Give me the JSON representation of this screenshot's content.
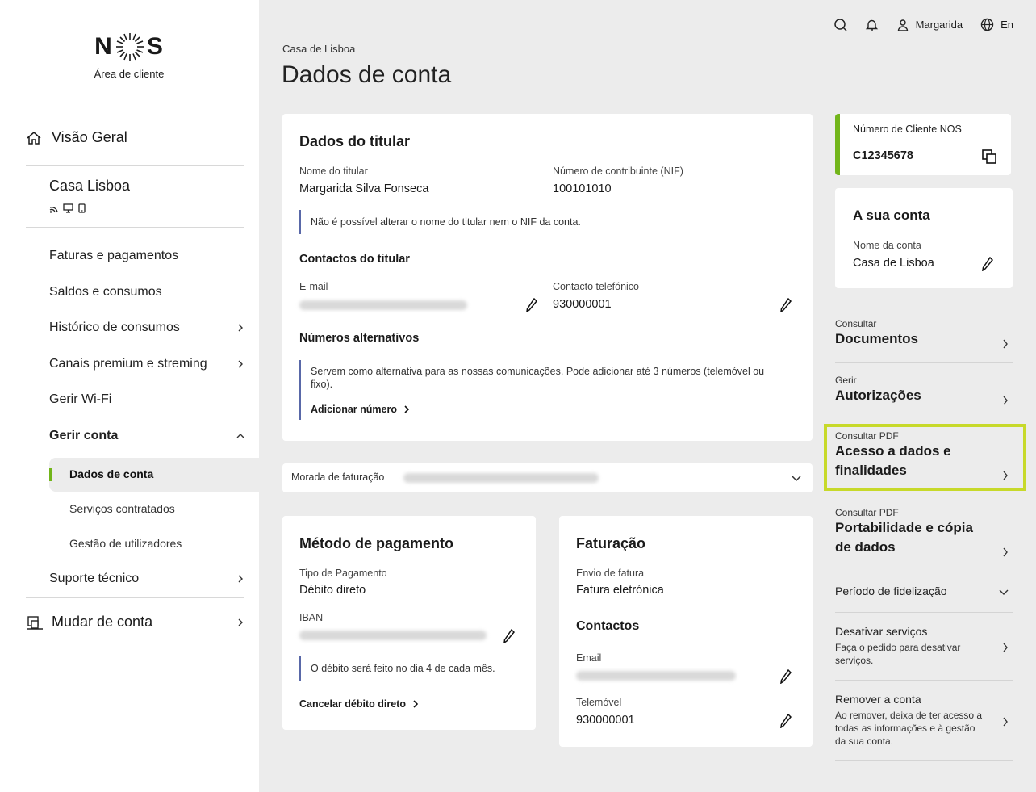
{
  "brand": {
    "logo_left": "N",
    "logo_right": "S",
    "subtitle": "Área de cliente"
  },
  "sidebar": {
    "overview": "Visão Geral",
    "account_name": "Casa Lisboa",
    "items": [
      {
        "label": "Faturas e pagamentos"
      },
      {
        "label": "Saldos e consumos"
      },
      {
        "label": "Histórico de consumos"
      },
      {
        "label": "Canais premium e streming"
      },
      {
        "label": "Gerir Wi-Fi"
      },
      {
        "label": "Gerir conta"
      }
    ],
    "sub_items": [
      {
        "label": "Dados de conta"
      },
      {
        "label": "Serviços contratados"
      },
      {
        "label": "Gestão de utilizadores"
      }
    ],
    "support": "Suporte técnico",
    "switch_account": "Mudar de conta"
  },
  "topbar": {
    "user": "Margarida",
    "language": "En"
  },
  "breadcrumb": "Casa de Lisboa",
  "page_title": "Dados de conta",
  "holder": {
    "title": "Dados do titular",
    "name_label": "Nome do titular",
    "name": "Margarida Silva Fonseca",
    "nif_label": "Número de contribuinte (NIF)",
    "nif": "100101010",
    "note": "Não é possível alterar o nome do titular nem o NIF da conta.",
    "contacts_title": "Contactos do titular",
    "email_label": "E-mail",
    "phone_label": "Contacto telefónico",
    "phone": "930000001",
    "alt_title": "Números alternativos",
    "alt_note": "Servem como alternativa para as nossas comunicações. Pode adicionar até 3 números (telemóvel ou fixo).",
    "add_number": "Adicionar número"
  },
  "billing_address": {
    "label": "Morada de faturação"
  },
  "payment": {
    "title": "Método de pagamento",
    "type_label": "Tipo de Pagamento",
    "type": "Débito direto",
    "iban_label": "IBAN",
    "note": "O débito será feito no dia 4 de cada mês.",
    "cancel": "Cancelar débito direto"
  },
  "invoice": {
    "title": "Faturação",
    "send_label": "Envio de fatura",
    "send": "Fatura eletrónica",
    "contacts_title": "Contactos",
    "email_label": "Email",
    "mobile_label": "Telemóvel",
    "mobile": "930000001"
  },
  "client_number": {
    "label": "Número de Cliente NOS",
    "value": "C12345678"
  },
  "your_account": {
    "title": "A sua conta",
    "name_label": "Nome da conta",
    "name": "Casa de Lisboa"
  },
  "right_links": [
    {
      "small": "Consultar",
      "big": "Documentos"
    },
    {
      "small": "Gerir",
      "big": "Autorizações"
    },
    {
      "small": "Consultar PDF",
      "big": "Acesso a dados e finalidades"
    },
    {
      "small": "Consultar PDF",
      "big": "Portabilidade e cópia de dados"
    }
  ],
  "fidelization": "Período de fidelização",
  "deactivate": {
    "title": "Desativar serviços",
    "desc": "Faça o pedido para desativar serviços."
  },
  "remove": {
    "title": "Remover a conta",
    "desc": "Ao remover, deixa de ter acesso a todas as informações e à gestão da sua conta."
  },
  "colors": {
    "accent_green": "#72b51a",
    "highlight": "#c7d92a",
    "note_bar": "#5968a8"
  }
}
